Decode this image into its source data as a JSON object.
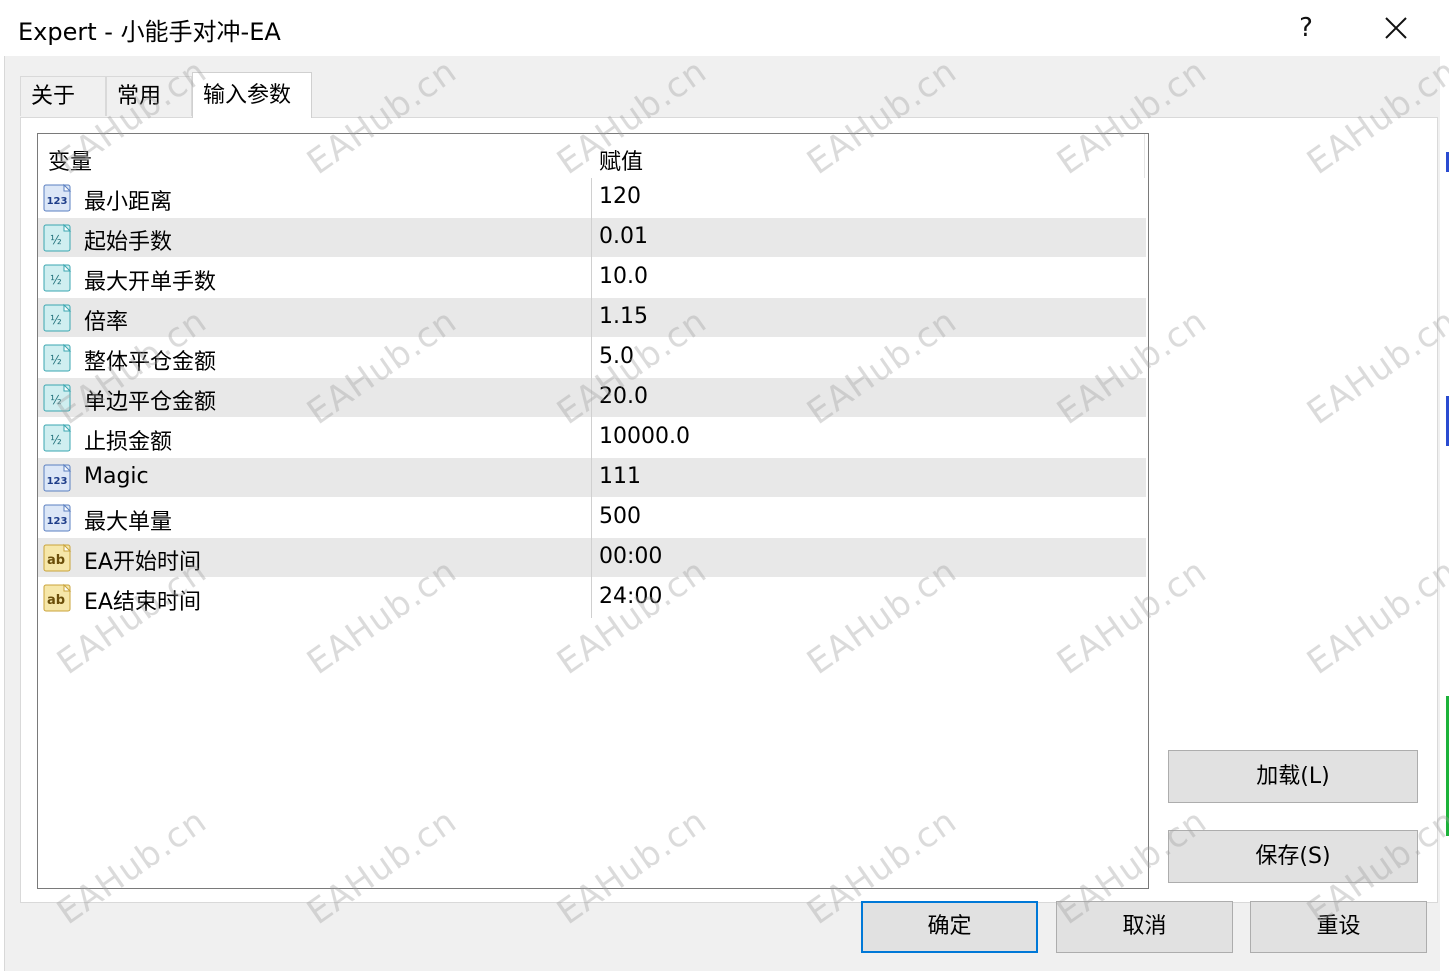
{
  "window": {
    "title": "Expert - 小能手对冲-EA",
    "help_label": "?"
  },
  "tabs": [
    {
      "label": "关于"
    },
    {
      "label": "常用"
    },
    {
      "label": "输入参数",
      "active": true
    }
  ],
  "table": {
    "columns": [
      "变量",
      "赋值"
    ],
    "rows": [
      {
        "type": "int",
        "icon": "int-123-icon",
        "name": "最小距离",
        "value": "120"
      },
      {
        "type": "double",
        "icon": "double-half-icon",
        "name": "起始手数",
        "value": "0.01"
      },
      {
        "type": "double",
        "icon": "double-half-icon",
        "name": "最大开单手数",
        "value": "10.0"
      },
      {
        "type": "double",
        "icon": "double-half-icon",
        "name": "倍率",
        "value": "1.15"
      },
      {
        "type": "double",
        "icon": "double-half-icon",
        "name": "整体平仓金额",
        "value": "5.0"
      },
      {
        "type": "double",
        "icon": "double-half-icon",
        "name": "单边平仓金额",
        "value": "20.0"
      },
      {
        "type": "double",
        "icon": "double-half-icon",
        "name": "止损金额",
        "value": "10000.0"
      },
      {
        "type": "int",
        "icon": "int-123-icon",
        "name": "Magic",
        "value": "111"
      },
      {
        "type": "int",
        "icon": "int-123-icon",
        "name": "最大单量",
        "value": "500"
      },
      {
        "type": "string",
        "icon": "string-ab-icon",
        "name": "EA开始时间",
        "value": "00:00"
      },
      {
        "type": "string",
        "icon": "string-ab-icon",
        "name": "EA结束时间",
        "value": "24:00"
      }
    ]
  },
  "buttons": {
    "load": "加载(L)",
    "save": "保存(S)",
    "ok": "确定",
    "cancel": "取消",
    "reset": "重设"
  },
  "watermark_text": "EAHub.cn",
  "colors": {
    "accent": "#0078d7",
    "row_alt": "#e8e8e8",
    "button_face": "#e1e1e1"
  }
}
